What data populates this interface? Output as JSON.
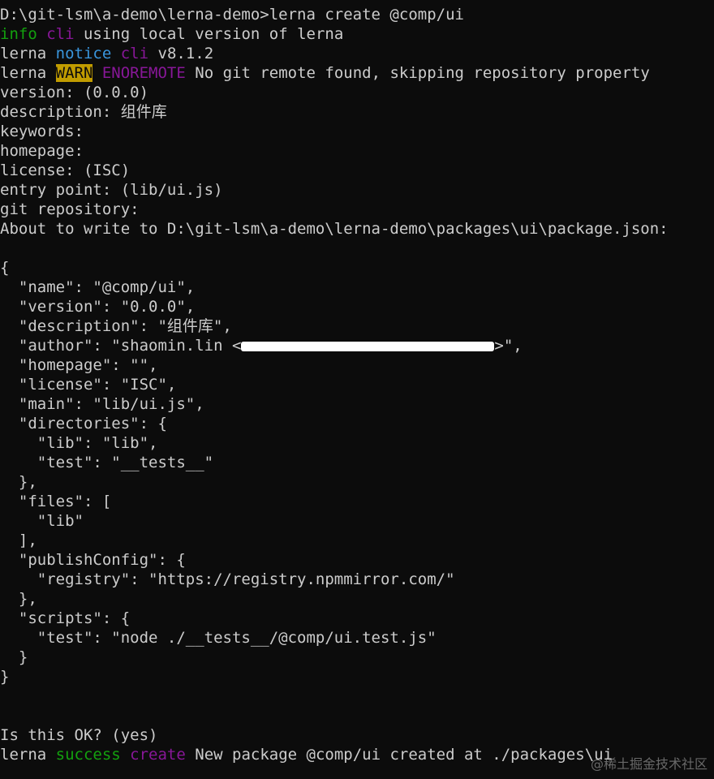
{
  "colors": {
    "background": "#0c0c0c",
    "text": "#cccccc",
    "green": "#13a10e",
    "magenta": "#881798",
    "blue": "#3a96dd",
    "warn_bg": "#c19c00"
  },
  "lines": [
    {
      "segments": [
        {
          "t": "D:\\git-lsm\\a-demo\\lerna-demo>lerna create @comp/ui"
        }
      ]
    },
    {
      "segments": [
        {
          "t": "info",
          "c": "green"
        },
        {
          "t": " "
        },
        {
          "t": "cli",
          "c": "magenta"
        },
        {
          "t": " using local version of lerna"
        }
      ]
    },
    {
      "segments": [
        {
          "t": "lerna "
        },
        {
          "t": "notice",
          "c": "blue"
        },
        {
          "t": " "
        },
        {
          "t": "cli",
          "c": "magenta"
        },
        {
          "t": " v8.1.2"
        }
      ]
    },
    {
      "segments": [
        {
          "t": "lerna "
        },
        {
          "t": "WARN",
          "c": "warn"
        },
        {
          "t": " "
        },
        {
          "t": "ENOREMOTE",
          "c": "magenta"
        },
        {
          "t": " No git remote found, skipping repository property"
        }
      ]
    },
    {
      "segments": [
        {
          "t": "version: (0.0.0)"
        }
      ]
    },
    {
      "segments": [
        {
          "t": "description: 组件库"
        }
      ]
    },
    {
      "segments": [
        {
          "t": "keywords:"
        }
      ]
    },
    {
      "segments": [
        {
          "t": "homepage:"
        }
      ]
    },
    {
      "segments": [
        {
          "t": "license: (ISC)"
        }
      ]
    },
    {
      "segments": [
        {
          "t": "entry point: (lib/ui.js)"
        }
      ]
    },
    {
      "segments": [
        {
          "t": "git repository:"
        }
      ]
    },
    {
      "segments": [
        {
          "t": "About to write to D:\\git-lsm\\a-demo\\lerna-demo\\packages\\ui\\package.json:"
        }
      ]
    },
    {
      "segments": []
    },
    {
      "segments": [
        {
          "t": "{"
        }
      ]
    },
    {
      "segments": [
        {
          "t": "  \"name\": \"@comp/ui\","
        }
      ]
    },
    {
      "segments": [
        {
          "t": "  \"version\": \"0.0.0\","
        }
      ]
    },
    {
      "segments": [
        {
          "t": "  \"description\": \"组件库\","
        }
      ]
    },
    {
      "segments": [
        {
          "t": "  \"author\": \"shaomin.lin <"
        },
        {
          "redact": true
        },
        {
          "t": ">\","
        }
      ]
    },
    {
      "segments": [
        {
          "t": "  \"homepage\": \"\","
        }
      ]
    },
    {
      "segments": [
        {
          "t": "  \"license\": \"ISC\","
        }
      ]
    },
    {
      "segments": [
        {
          "t": "  \"main\": \"lib/ui.js\","
        }
      ]
    },
    {
      "segments": [
        {
          "t": "  \"directories\": {"
        }
      ]
    },
    {
      "segments": [
        {
          "t": "    \"lib\": \"lib\","
        }
      ]
    },
    {
      "segments": [
        {
          "t": "    \"test\": \"__tests__\""
        }
      ]
    },
    {
      "segments": [
        {
          "t": "  },"
        }
      ]
    },
    {
      "segments": [
        {
          "t": "  \"files\": ["
        }
      ]
    },
    {
      "segments": [
        {
          "t": "    \"lib\""
        }
      ]
    },
    {
      "segments": [
        {
          "t": "  ],"
        }
      ]
    },
    {
      "segments": [
        {
          "t": "  \"publishConfig\": {"
        }
      ]
    },
    {
      "segments": [
        {
          "t": "    \"registry\": \"https://registry.npmmirror.com/\""
        }
      ]
    },
    {
      "segments": [
        {
          "t": "  },"
        }
      ]
    },
    {
      "segments": [
        {
          "t": "  \"scripts\": {"
        }
      ]
    },
    {
      "segments": [
        {
          "t": "    \"test\": \"node ./__tests__/@comp/ui.test.js\""
        }
      ]
    },
    {
      "segments": [
        {
          "t": "  }"
        }
      ]
    },
    {
      "segments": [
        {
          "t": "}"
        }
      ]
    },
    {
      "segments": []
    },
    {
      "segments": []
    },
    {
      "segments": [
        {
          "t": "Is this OK? (yes)"
        }
      ]
    },
    {
      "segments": [
        {
          "t": "lerna "
        },
        {
          "t": "success",
          "c": "green"
        },
        {
          "t": " "
        },
        {
          "t": "create",
          "c": "magenta"
        },
        {
          "t": " New package @comp/ui created at ./packages\\ui"
        }
      ]
    }
  ],
  "watermark": "@稀土掘金技术社区"
}
